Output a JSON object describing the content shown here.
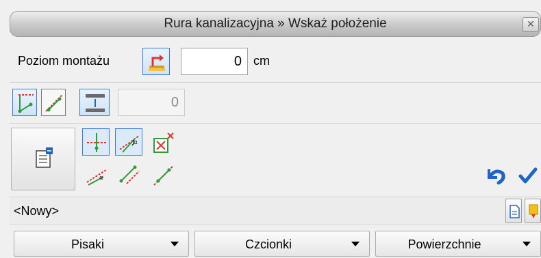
{
  "dialog": {
    "title": "Rura kanalizacyjna » Wskaż położenie",
    "close_icon": "close-icon"
  },
  "mounting": {
    "label": "Poziom montażu",
    "value": "0",
    "unit": "cm"
  },
  "snap_row": {
    "offset_value": "0"
  },
  "element": {
    "current": "<Nowy>"
  },
  "bottom": {
    "pens_label": "Pisaki",
    "fonts_label": "Czcionki",
    "surfaces_label": "Powierzchnie"
  },
  "colors": {
    "accent": "#3a7bd5",
    "icon_red": "#e0342b",
    "icon_green": "#2e9a3a",
    "confirm_blue": "#1f64c8"
  }
}
